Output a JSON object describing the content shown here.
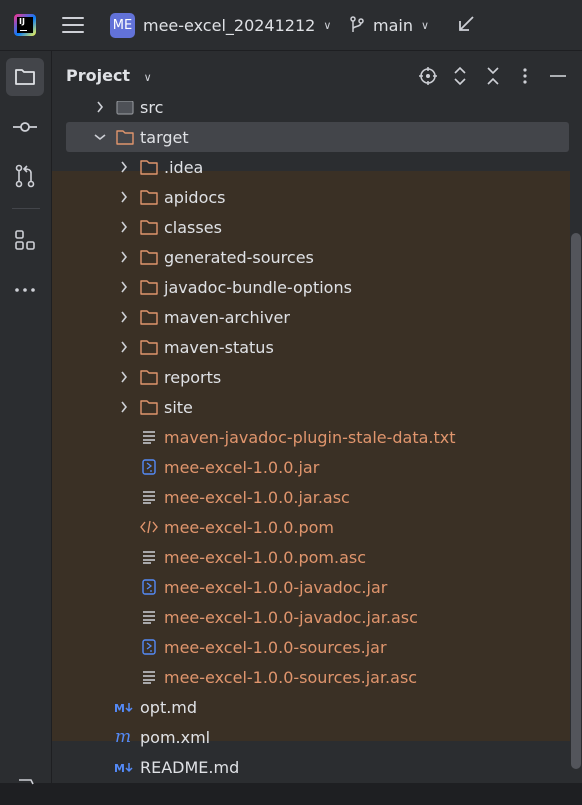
{
  "titlebar": {
    "project_badge": "ME",
    "project_name": "mee-excel_20241212",
    "branch": "main"
  },
  "toolstrip": {
    "items": [
      "folder-icon",
      "commit-icon",
      "pull-requests-icon",
      "structure-icon",
      "more-icon"
    ]
  },
  "panel": {
    "title": "Project"
  },
  "tree": {
    "src": "src",
    "target": "target",
    "folders": [
      ".idea",
      "apidocs",
      "classes",
      "generated-sources",
      "javadoc-bundle-options",
      "maven-archiver",
      "maven-status",
      "reports",
      "site"
    ],
    "files": [
      {
        "name": "maven-javadoc-plugin-stale-data.txt",
        "icon": "text-file-icon"
      },
      {
        "name": "mee-excel-1.0.0.jar",
        "icon": "jar-file-icon"
      },
      {
        "name": "mee-excel-1.0.0.jar.asc",
        "icon": "text-file-icon"
      },
      {
        "name": "mee-excel-1.0.0.pom",
        "icon": "xml-file-icon"
      },
      {
        "name": "mee-excel-1.0.0.pom.asc",
        "icon": "text-file-icon"
      },
      {
        "name": "mee-excel-1.0.0-javadoc.jar",
        "icon": "jar-file-icon"
      },
      {
        "name": "mee-excel-1.0.0-javadoc.jar.asc",
        "icon": "text-file-icon"
      },
      {
        "name": "mee-excel-1.0.0-sources.jar",
        "icon": "jar-file-icon"
      },
      {
        "name": "mee-excel-1.0.0-sources.jar.asc",
        "icon": "text-file-icon"
      }
    ],
    "root_files": [
      {
        "name": "opt.md",
        "icon": "markdown-icon"
      },
      {
        "name": "pom.xml",
        "icon": "maven-icon"
      },
      {
        "name": "README.md",
        "icon": "markdown-icon"
      }
    ]
  },
  "colors": {
    "excluded_text": "#e0956d",
    "excluded_highlight": "#3a3025",
    "folder_excluded": "#e0956d",
    "badge": "#6272d8"
  }
}
